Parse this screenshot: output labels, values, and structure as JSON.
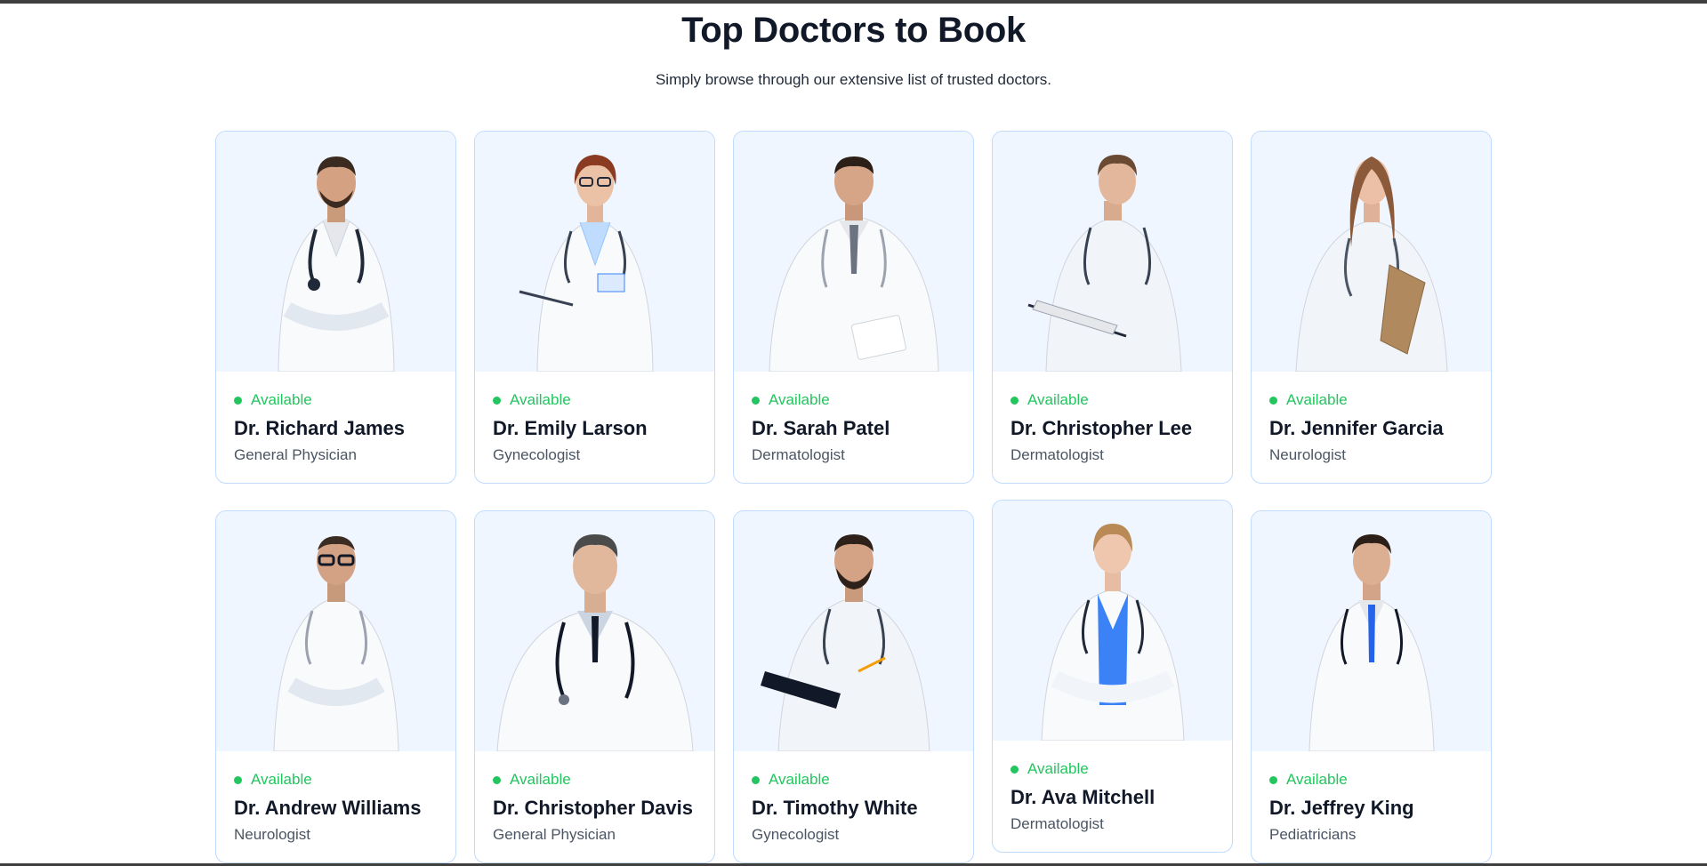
{
  "header": {
    "title": "Top Doctors to Book",
    "subtitle": "Simply browse through our extensive list of trusted doctors."
  },
  "doctors": [
    {
      "status": "Available",
      "name": "Dr. Richard James",
      "speciality": "General Physician"
    },
    {
      "status": "Available",
      "name": "Dr. Emily Larson",
      "speciality": "Gynecologist"
    },
    {
      "status": "Available",
      "name": "Dr. Sarah Patel",
      "speciality": "Dermatologist"
    },
    {
      "status": "Available",
      "name": "Dr. Christopher Lee",
      "speciality": "Dermatologist"
    },
    {
      "status": "Available",
      "name": "Dr. Jennifer Garcia",
      "speciality": "Neurologist"
    },
    {
      "status": "Available",
      "name": "Dr. Andrew Williams",
      "speciality": "Neurologist"
    },
    {
      "status": "Available",
      "name": "Dr. Christopher Davis",
      "speciality": "General Physician"
    },
    {
      "status": "Available",
      "name": "Dr. Timothy White",
      "speciality": "Gynecologist"
    },
    {
      "status": "Available",
      "name": "Dr. Ava Mitchell",
      "speciality": "Dermatologist"
    },
    {
      "status": "Available",
      "name": "Dr. Jeffrey King",
      "speciality": "Pediatricians"
    }
  ],
  "colors": {
    "available": "#22c55e",
    "card_border": "#bfdbfe",
    "photo_bg": "#eff6ff"
  }
}
